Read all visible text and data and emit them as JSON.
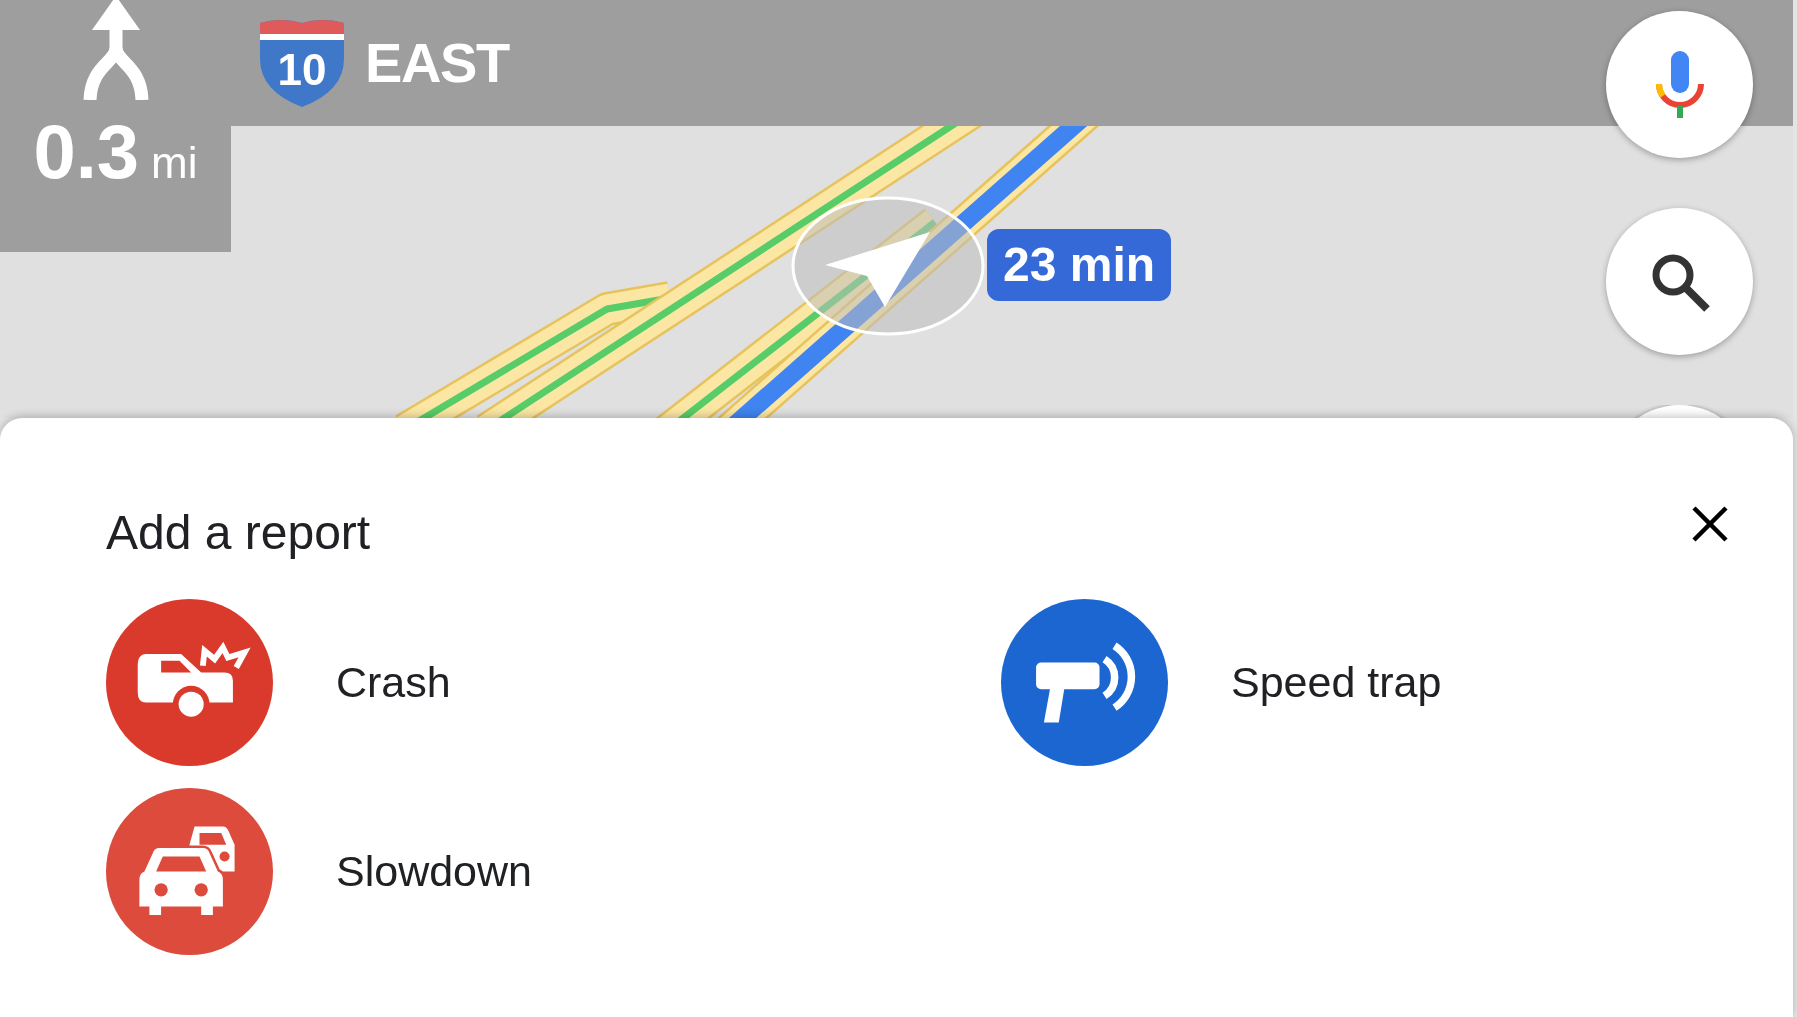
{
  "maneuver": {
    "distance": "0.3",
    "unit": "mi"
  },
  "road": {
    "shield_number": "10",
    "direction": "EAST"
  },
  "map": {
    "eta": "23 min"
  },
  "report_sheet": {
    "title": "Add a report",
    "options": [
      {
        "label": "Crash",
        "kind": "crash",
        "color": "#d93a2b"
      },
      {
        "label": "Speed trap",
        "kind": "speed_trap",
        "color": "#1b66d0"
      },
      {
        "label": "Slowdown",
        "kind": "slowdown",
        "color": "#dc4b3c"
      }
    ]
  }
}
